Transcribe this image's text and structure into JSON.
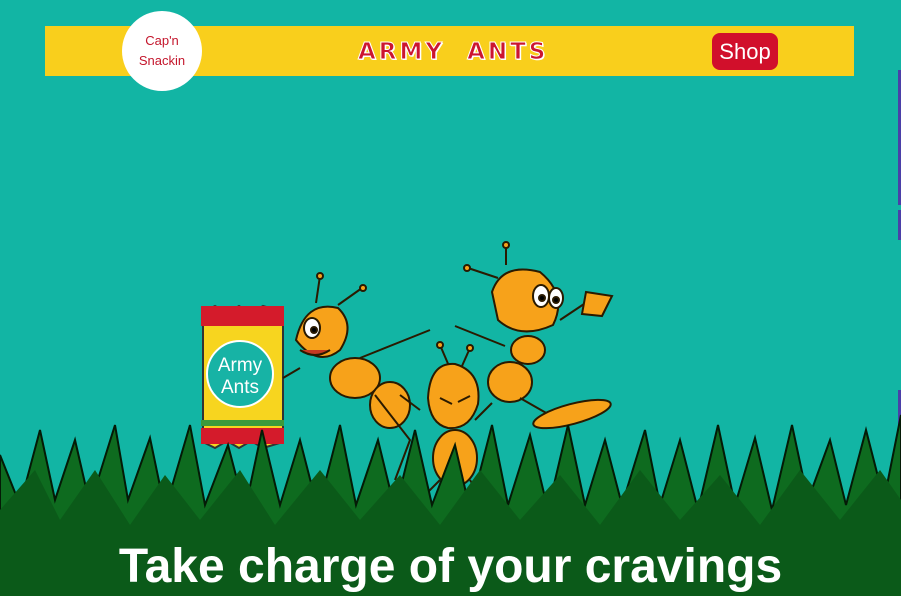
{
  "header": {
    "logo_line1": "Cap'n",
    "logo_line2": "Snackin",
    "brand": "ARMY  ANTS",
    "shop_label": "Shop"
  },
  "hero": {
    "bag_line1": "Army",
    "bag_line2": "Ants",
    "headline": "Take charge of your cravings"
  },
  "colors": {
    "background": "#12b5a4",
    "topbar": "#f9cf1c",
    "brand_red": "#cc1530",
    "shop_button": "#d10f2b",
    "grass_dark": "#0d5a1a",
    "ant_orange": "#f7a21a"
  },
  "icons": [
    "ant-character-icon",
    "snack-bag-icon",
    "grass-icon"
  ]
}
